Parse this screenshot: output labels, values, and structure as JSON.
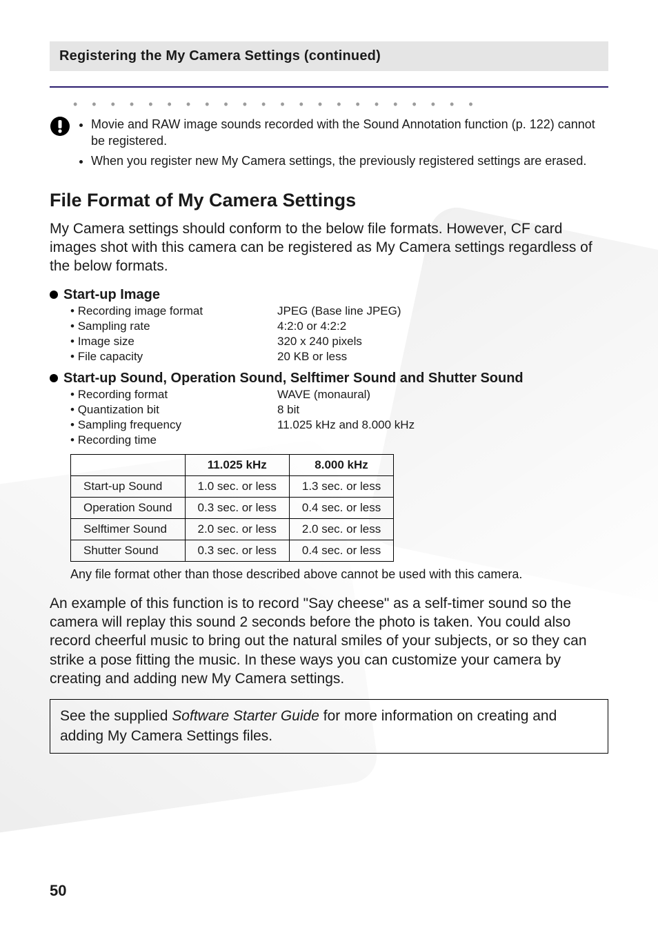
{
  "section_header": "Registering the My Camera Settings (continued)",
  "notes": [
    "Movie and RAW image sounds recorded with the Sound Annotation function (p. 122) cannot be registered.",
    "When you register new My Camera settings, the previously registered settings are erased."
  ],
  "h2": "File Format of My Camera Settings",
  "intro": "My Camera settings should conform to the below file formats. However, CF card images shot with this camera can be registered as My Camera settings regardless of the below formats.",
  "startup_image": {
    "heading": "Start-up Image",
    "rows": [
      {
        "label": "Recording image format",
        "value": "JPEG (Base line JPEG)"
      },
      {
        "label": "Sampling rate",
        "value": "4:2:0 or 4:2:2"
      },
      {
        "label": "Image size",
        "value": "320 x 240 pixels"
      },
      {
        "label": "File capacity",
        "value": "20 KB or less"
      }
    ]
  },
  "sounds": {
    "heading": "Start-up Sound, Operation Sound, Selftimer Sound and Shutter Sound",
    "rows": [
      {
        "label": "Recording format",
        "value": "WAVE (monaural)"
      },
      {
        "label": "Quantization bit",
        "value": "8 bit"
      },
      {
        "label": "Sampling frequency",
        "value": "11.025 kHz and 8.000 kHz"
      },
      {
        "label": "Recording time",
        "value": ""
      }
    ]
  },
  "rec_table": {
    "headers": [
      "",
      "11.025 kHz",
      "8.000 kHz"
    ],
    "rows": [
      [
        "Start-up Sound",
        "1.0 sec. or less",
        "1.3 sec. or less"
      ],
      [
        "Operation Sound",
        "0.3 sec. or less",
        "0.4 sec. or less"
      ],
      [
        "Selftimer Sound",
        "2.0 sec. or less",
        "2.0 sec. or less"
      ],
      [
        "Shutter Sound",
        "0.3 sec. or less",
        "0.4 sec. or less"
      ]
    ]
  },
  "table_footnote": "Any file format other than those described above cannot be used with this camera.",
  "example_para": "An example of this function is to record \"Say cheese\" as a self-timer sound so the camera will replay this sound 2 seconds before the photo is taken. You could also record cheerful music to bring out the natural smiles of your subjects, or so they can strike a pose fitting the music. In these ways you can customize your camera by creating and adding new My Camera settings.",
  "boxed_pre": "See the supplied ",
  "boxed_italic": "Software Starter Guide",
  "boxed_post": " for more information on creating and adding My Camera Settings files.",
  "page_number": "50"
}
